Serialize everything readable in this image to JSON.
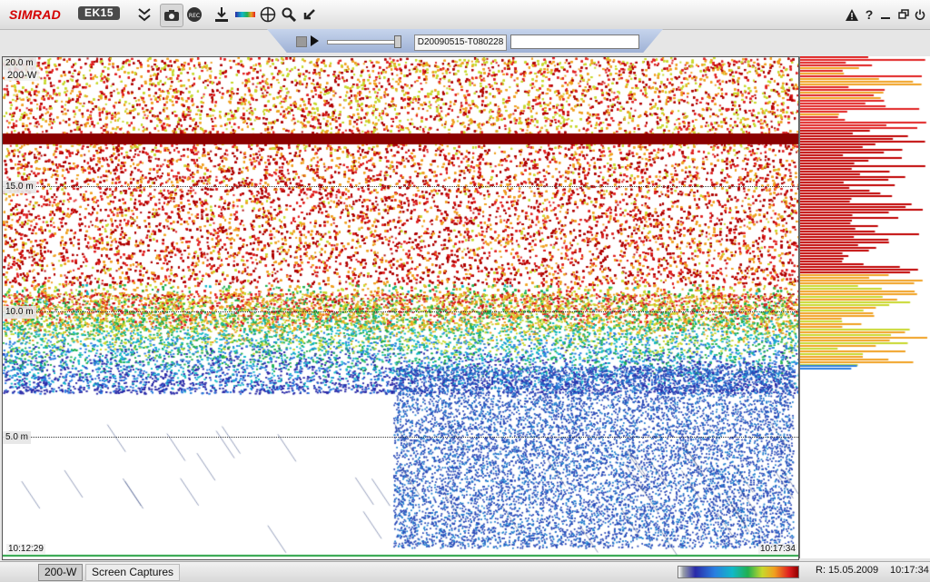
{
  "app": {
    "brand": "SIMRAD",
    "model": "EK15"
  },
  "replay": {
    "file": "D20090515-T080228"
  },
  "echogram": {
    "channel": "200-W",
    "depth_labels": [
      "20.0 m",
      "15.0 m",
      "10.0 m",
      "5.0 m"
    ],
    "start_time": "10:12:29",
    "end_time": "10:17:34"
  },
  "statusbar": {
    "channel_tab": "200-W",
    "screen_captures_tab": "Screen Captures",
    "replay_date": "R: 15.05.2009",
    "clock": "10:17:34"
  },
  "colors": {
    "brand_red": "#d40000",
    "toolbar_blue": "#9fb2d6"
  }
}
